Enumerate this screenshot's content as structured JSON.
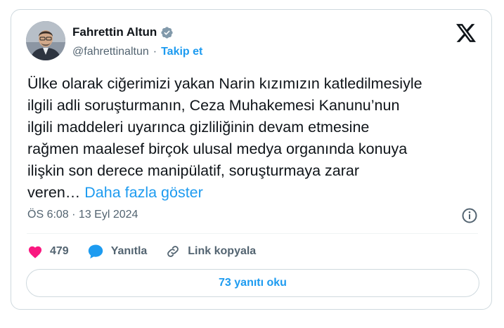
{
  "author": {
    "name": "Fahrettin Altun",
    "handle": "@fahrettinaltun",
    "separator": "·",
    "follow_label": "Takip et"
  },
  "tweet": {
    "text": "Ülke olarak ciğerimizi yakan Narin kızımızın katledilmesiyle\nilgili adli soruşturmanın, Ceza Muhakemesi Kanunu’nun\nilgili maddeleri uyarınca gizliliğinin devam etmesine\nrağmen maalesef birçok ulusal medya organında konuya\nilişkin son derece manipülatif, soruşturmaya zarar\nveren…",
    "show_more": "Daha fazla göster",
    "timestamp": "ÖS 6:08 · 13 Eyl 2024"
  },
  "actions": {
    "likes": "479",
    "reply_label": "Yanıtla",
    "copy_link_label": "Link kopyala"
  },
  "read_replies": "73 yanıtı oku",
  "colors": {
    "accent": "#1d9bf0",
    "like": "#f91880",
    "text": "#0f1419",
    "muted": "#536471",
    "border": "#cfd9de"
  },
  "icons": [
    "verified-badge-icon",
    "x-logo-icon",
    "info-icon",
    "heart-icon",
    "reply-bubble-icon",
    "link-icon"
  ]
}
